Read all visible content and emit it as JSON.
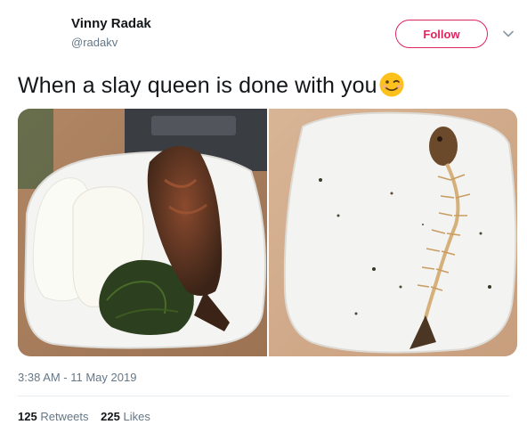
{
  "tweet": {
    "display_name": "Vinny Radak",
    "handle": "@radakv",
    "text": "When a slay queen is done with you",
    "emoji": "winking-face-emoji",
    "timestamp": "3:38 AM - 11 May 2019",
    "follow_label": "Follow",
    "retweets_count": "125",
    "retweets_label": "Retweets",
    "likes_count": "225",
    "likes_label": "Likes"
  },
  "colors": {
    "accent": "#e0245e",
    "muted": "#657786",
    "text": "#14171a",
    "divider": "#e6ecf0"
  },
  "icons": {
    "more": "chevron-down-icon"
  }
}
